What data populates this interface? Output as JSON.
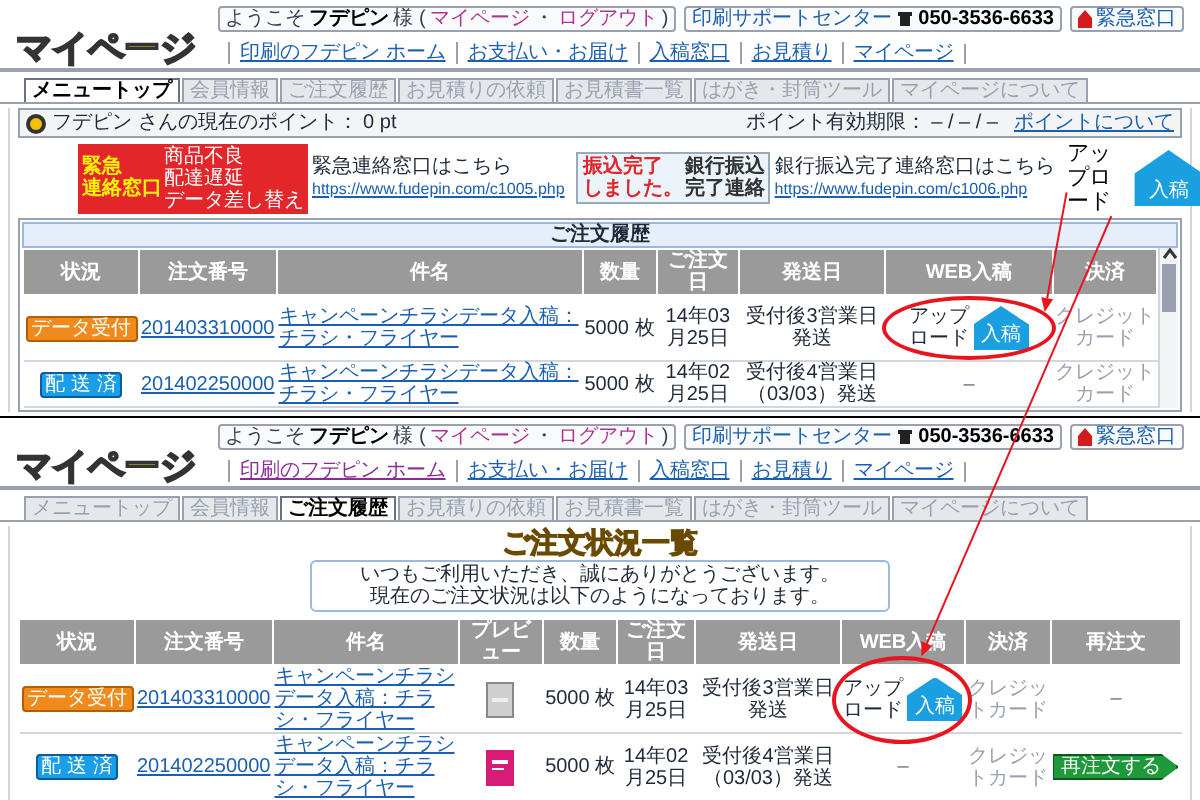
{
  "panels": [
    {
      "header": {
        "logo": "マイページ",
        "welcome": [
          {
            "kind": "plain",
            "text": "ようこそ"
          },
          {
            "kind": "bold",
            "text": "フデピン"
          },
          {
            "kind": "plain",
            "text": "様 ("
          },
          {
            "kind": "link",
            "text": "マイページ"
          },
          {
            "kind": "plain",
            "text": "・"
          },
          {
            "kind": "link",
            "text": "ログアウト"
          },
          {
            "kind": "plain",
            "text": ")"
          }
        ],
        "support": "印刷サポートセンター",
        "phone": "050-3536-6633",
        "emergency": "緊急窓口",
        "nav": [
          {
            "label": "印刷のフデピン ホーム",
            "visited": false
          },
          {
            "label": "お支払い・お届け",
            "visited": false
          },
          {
            "label": "入稿窓口",
            "visited": false
          },
          {
            "label": "お見積り",
            "visited": false
          },
          {
            "label": "マイページ",
            "visited": false
          }
        ]
      },
      "tabs": [
        {
          "label": "メニュートップ",
          "selected": true
        },
        {
          "label": "会員情報",
          "selected": false
        },
        {
          "label": "ご注文履歴",
          "selected": false
        },
        {
          "label": "お見積りの依頼",
          "selected": false
        },
        {
          "label": "お見積書一覧",
          "selected": false
        },
        {
          "label": "はがき・封筒ツール",
          "selected": false
        },
        {
          "label": "マイページについて",
          "selected": false
        }
      ],
      "points": {
        "balance": "フデピン さんの現在のポイント： 0 pt",
        "expiry": "ポイント有効期限： – / – / –",
        "link": "ポイントについて"
      },
      "banners": [
        {
          "kind": "emergency",
          "big": [
            "緊急",
            "連絡窓口"
          ],
          "small": [
            "商品不良",
            "配達遅延",
            "データ差し替え"
          ],
          "caption": "緊急連絡窓口はこちら",
          "url": "https://www.fudepin.com/c1005.php"
        },
        {
          "kind": "bank",
          "big": [
            "振込完了",
            "しました。"
          ],
          "small": [
            "銀行振込",
            "完了連絡"
          ],
          "caption": "銀行振込完了連絡窓口はこちら",
          "url": "https://www.fudepin.com/c1006.php"
        }
      ],
      "orders": {
        "title": "ご注文履歴",
        "columns": [
          "状況",
          "注文番号",
          "件名",
          "数量",
          "ご注文日",
          "発送日",
          "WEB入稿",
          "決済"
        ],
        "rows": [
          {
            "status": {
              "kind": "data",
              "label": "データ受付"
            },
            "number": "201403310000",
            "name": "キャンペーンチラシデータ入稿：チラシ・フライヤー",
            "quantity": "5000 枚",
            "ordered": "14年03月25日",
            "ship": "受付後3営業日発送",
            "upload": {
              "kind": "button",
              "label": "アップロード",
              "button": "入稿"
            },
            "payment": "クレジットカード"
          },
          {
            "status": {
              "kind": "shipped",
              "label": "配 送 済"
            },
            "number": "201402250000",
            "name": "キャンペーンチラシデータ入稿：チラシ・フライヤー",
            "quantity": "5000 枚",
            "ordered": "14年02月25日",
            "ship": "受付後4営業日（03/03）発送",
            "upload": {
              "kind": "none",
              "text": "–"
            },
            "payment": "クレジットカード"
          }
        ]
      }
    },
    {
      "header": {
        "logo": "マイページ",
        "welcome": [
          {
            "kind": "plain",
            "text": "ようこそ"
          },
          {
            "kind": "bold",
            "text": "フデピン"
          },
          {
            "kind": "plain",
            "text": "様 ("
          },
          {
            "kind": "link",
            "text": "マイページ"
          },
          {
            "kind": "plain",
            "text": "・"
          },
          {
            "kind": "link",
            "text": "ログアウト"
          },
          {
            "kind": "plain",
            "text": ")"
          }
        ],
        "support": "印刷サポートセンター",
        "phone": "050-3536-6633",
        "emergency": "緊急窓口",
        "nav": [
          {
            "label": "印刷のフデピン ホーム",
            "visited": true
          },
          {
            "label": "お支払い・お届け",
            "visited": false
          },
          {
            "label": "入稿窓口",
            "visited": false
          },
          {
            "label": "お見積り",
            "visited": false
          },
          {
            "label": "マイページ",
            "visited": false
          }
        ]
      },
      "tabs": [
        {
          "label": "メニュートップ",
          "selected": false
        },
        {
          "label": "会員情報",
          "selected": false
        },
        {
          "label": "ご注文履歴",
          "selected": true
        },
        {
          "label": "お見積りの依頼",
          "selected": false
        },
        {
          "label": "お見積書一覧",
          "selected": false
        },
        {
          "label": "はがき・封筒ツール",
          "selected": false
        },
        {
          "label": "マイページについて",
          "selected": false
        }
      ],
      "page_title": "ご注文状況一覧",
      "notice": [
        "いつもご利用いただき、誠にありがとうございます。",
        "現在のご注文状況は以下のようになっております。"
      ],
      "orders": {
        "columns": [
          "状況",
          "注文番号",
          "件名",
          "プレビュー",
          "数量",
          "ご注文日",
          "発送日",
          "WEB入稿",
          "決済",
          "再注文"
        ],
        "rows": [
          {
            "status": {
              "kind": "data",
              "label": "データ受付"
            },
            "number": "201403310000",
            "name": "キャンペーンチラシデータ入稿：チラシ・フライヤー",
            "preview": {
              "kind": "pending"
            },
            "quantity": "5000 枚",
            "ordered": "14年03月25日",
            "ship": "受付後3営業日発送",
            "upload": {
              "kind": "button",
              "label": "アップロード",
              "button": "入稿"
            },
            "payment": "クレジットカード",
            "reorder": {
              "kind": "none",
              "text": "–"
            }
          },
          {
            "status": {
              "kind": "shipped",
              "label": "配 送 済"
            },
            "number": "201402250000",
            "name": "キャンペーンチラシデータ入稿：チラシ・フライヤー",
            "quantity": "5000 枚",
            "ordered": "14年02月25日",
            "ship": "受付後4営業日（03/03）発送",
            "upload": {
              "kind": "none",
              "text": "–"
            },
            "payment": "クレジットカード",
            "reorder": {
              "kind": "button",
              "label": "再注文する"
            }
          }
        ]
      }
    }
  ],
  "callout": {
    "text": "アップロード",
    "button": "入稿"
  }
}
